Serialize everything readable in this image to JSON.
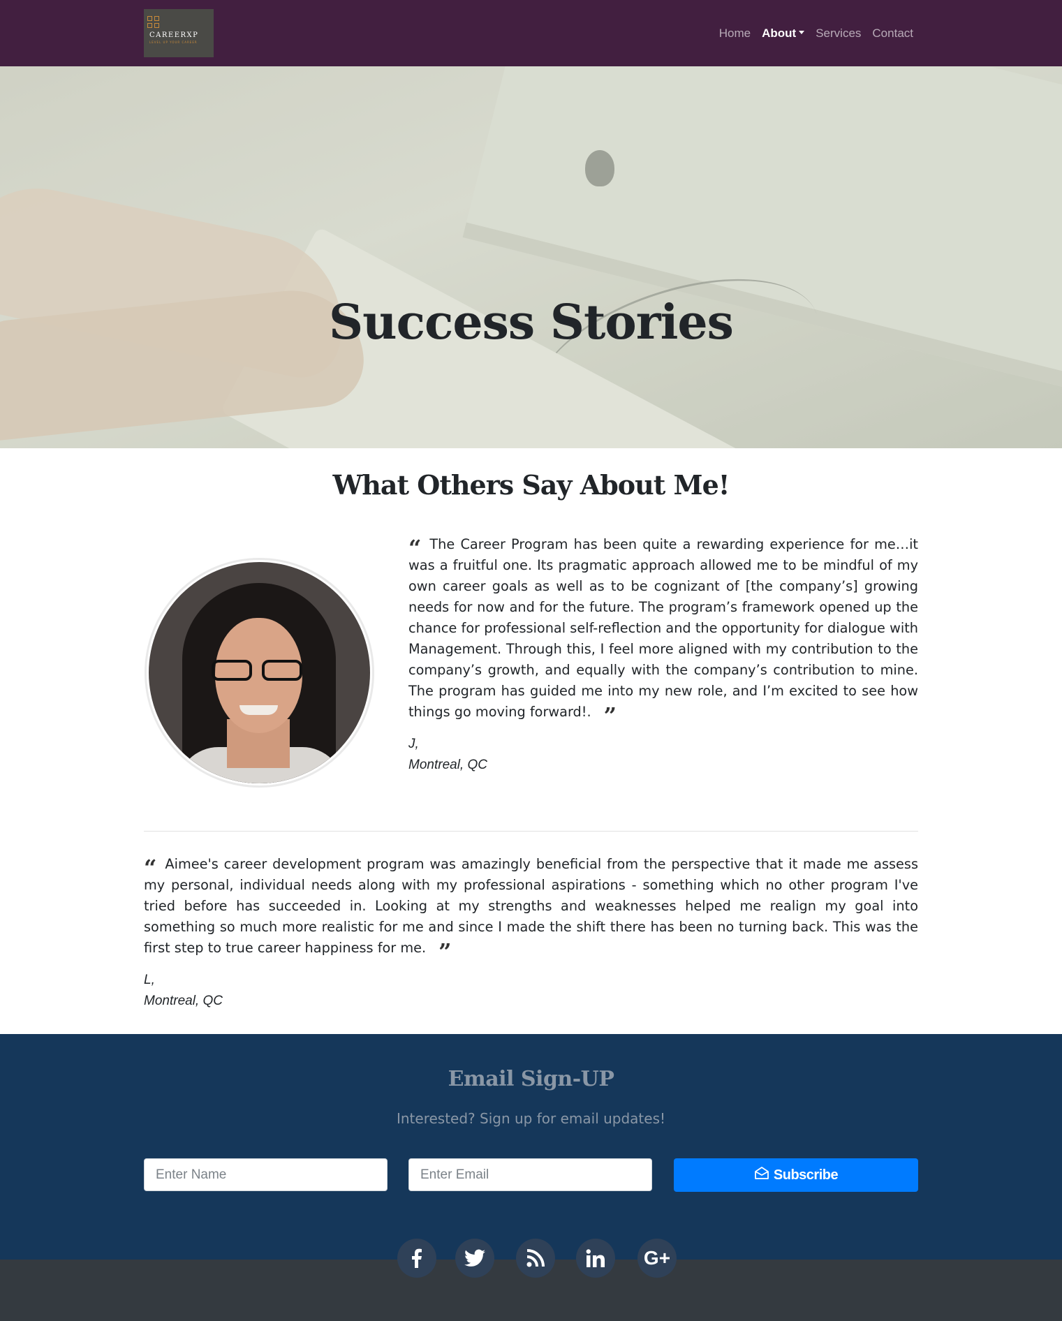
{
  "navbar": {
    "logo": {
      "name": "CAREERXP",
      "tagline": "LEVEL UP YOUR CAREER"
    },
    "links": [
      {
        "label": "Home"
      },
      {
        "label": "About"
      },
      {
        "label": "Services"
      },
      {
        "label": "Contact"
      }
    ]
  },
  "hero": {
    "title": "Success Stories"
  },
  "testimonials": {
    "heading": "What Others Say About Me!",
    "items": [
      {
        "quote": "The Career Program has been quite a rewarding experience for me…it was a fruitful one. Its pragmatic approach allowed me to be mindful of my own career goals as well as to be cognizant of [the company’s] growing needs for now and for the future. The program’s framework opened up the chance for professional self-reflection and the opportunity for dialogue with Management. Through this, I feel more aligned with my contribution to the company’s growth, and equally with the company’s contribution to mine. The program has guided me into my new role, and I’m excited to see how things go moving forward!.",
        "author": "J,",
        "location": "Montreal, QC"
      },
      {
        "quote": "Aimee's career development program was amazingly beneficial from the perspective that it made me assess my personal, individual needs along with my professional aspirations - something which no other program I've tried before has succeeded in. Looking at my strengths and weaknesses helped me realign my goal into something so much more realistic for me and since I made the shift there has been no turning back. This was the first step to true career happiness for me.",
        "author": "L,",
        "location": "Montreal, QC"
      }
    ]
  },
  "signup": {
    "title": "Email Sign-UP",
    "subtitle": "Interested? Sign up for email updates!",
    "name_placeholder": "Enter Name",
    "email_placeholder": "Enter Email",
    "button_label": "Subscribe"
  },
  "social": [
    {
      "icon": "facebook-icon"
    },
    {
      "icon": "twitter-icon"
    },
    {
      "icon": "rss-icon"
    },
    {
      "icon": "linkedin-icon"
    },
    {
      "icon": "google-plus-icon",
      "label": "G+"
    }
  ],
  "colors": {
    "navbar": "#421f40",
    "signup_bg": "#15375a",
    "footer_bg": "#343a40",
    "button": "#007bff",
    "logo_accent": "#c98a3a"
  }
}
